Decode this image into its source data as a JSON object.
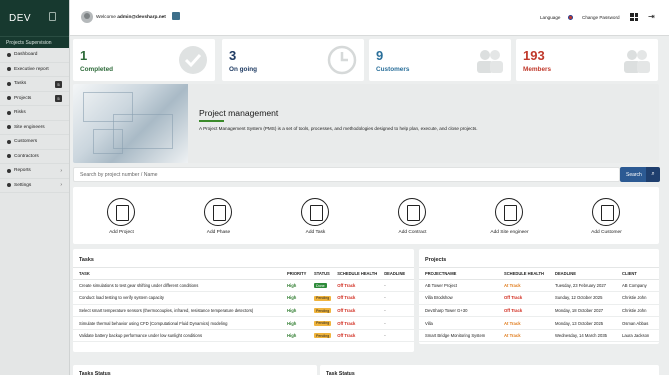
{
  "brand": {
    "name": "DEV"
  },
  "sidebar": {
    "section": "Projects Supervision",
    "items": [
      {
        "label": "Dashboard",
        "icon": "dashboard-icon"
      },
      {
        "label": "Executive report",
        "icon": "report-icon"
      },
      {
        "label": "Tasks",
        "icon": "tasks-icon",
        "badge": "5"
      },
      {
        "label": "Projects",
        "icon": "projects-icon",
        "badge": "5"
      },
      {
        "label": "Risks",
        "icon": "risks-icon"
      },
      {
        "label": "Site engineers",
        "icon": "engineer-icon"
      },
      {
        "label": "Customers",
        "icon": "customers-icon"
      },
      {
        "label": "Contractors",
        "icon": "contractors-icon"
      },
      {
        "label": "Reports",
        "icon": "reports-icon",
        "chevron": "›"
      },
      {
        "label": "Settings",
        "icon": "settings-icon",
        "chevron": "›"
      }
    ]
  },
  "topbar": {
    "welcome": "Welcome",
    "user": "admin@devsharp.net",
    "language": "Language",
    "change_password": "Change Password"
  },
  "stats": [
    {
      "num": "1",
      "label": "Completed",
      "color": "#2e6b3a"
    },
    {
      "num": "3",
      "label": "On going",
      "color": "#1f3b63"
    },
    {
      "num": "9",
      "label": "Customers",
      "color": "#2a6f9a"
    },
    {
      "num": "193",
      "label": "Members",
      "color": "#c0392b"
    }
  ],
  "banner": {
    "title": "Project management",
    "desc": "A Project Management System (PMS) is a set of tools, processes, and methodologies designed to help plan, execute, and close projects."
  },
  "search": {
    "placeholder": "Search by project number / Name",
    "button": "Search"
  },
  "actions": [
    {
      "label": "Add Project",
      "icon": "add-project-icon"
    },
    {
      "label": "Add Phase",
      "icon": "add-phase-icon"
    },
    {
      "label": "Add Task",
      "icon": "add-task-icon"
    },
    {
      "label": "Add Contract",
      "icon": "add-contract-icon"
    },
    {
      "label": "Add Site engineer",
      "icon": "add-engineer-icon"
    },
    {
      "label": "Add Customer",
      "icon": "add-customer-icon"
    }
  ],
  "tasks": {
    "title": "Tasks",
    "columns": [
      "TASK",
      "PRIORITY",
      "STATUS",
      "SCHEDULE HEALTH",
      "DEADLINE"
    ],
    "rows": [
      [
        "Create simulations to test gear shifting under different conditions",
        "High",
        "Done",
        "Off Track",
        "-"
      ],
      [
        "Conduct load testing to verify system capacity",
        "High",
        "Pending",
        "Off Track",
        "-"
      ],
      [
        "Select smart temperature sensors (thermocouples, infrared, resistance temperature detectors)",
        "High",
        "Pending",
        "Off Track",
        "-"
      ],
      [
        "Simulate thermal behavior using CFD (Computational Fluid Dynamics) modeling",
        "High",
        "Pending",
        "Off Track",
        "-"
      ],
      [
        "Validate battery backup performance under low sunlight conditions",
        "High",
        "Pending",
        "Off Track",
        "-"
      ]
    ]
  },
  "projects": {
    "title": "Projects",
    "columns": [
      "PROJECTNAME",
      "SCHEDULE HEALTH",
      "DEADLINE",
      "CLIENT"
    ],
    "rows": [
      [
        "AB Tower Project",
        "At Track",
        "Tuesday, 23 February 2027",
        "AB Company"
      ],
      [
        "Villa Brodshow",
        "Off Track",
        "Sunday, 12 October 2025",
        "Christie John"
      ],
      [
        "DevSharp Tower G+30",
        "Off Track",
        "Monday, 18 October 2027",
        "Christie John"
      ],
      [
        "Villa",
        "At Track",
        "Monday, 13 October 2025",
        "Osman Abbas"
      ],
      [
        "Smart Bridge Monitoring System",
        "At Track",
        "Wednesday, 14 March 2035",
        "Laura Jackson"
      ]
    ]
  },
  "bottom": {
    "left": "Tasks Status",
    "right": "Task Status"
  }
}
